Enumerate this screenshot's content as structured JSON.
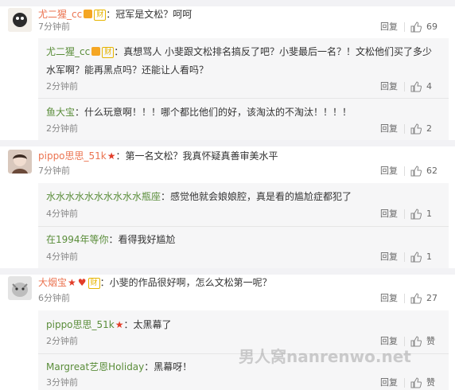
{
  "comments": [
    {
      "user": "尤二猩_cc",
      "text": "：冠军是文松？呵呵",
      "time": "7分钟前",
      "reply": "回复",
      "likes": "69",
      "replies": [
        {
          "user": "尤二猩_cc",
          "text": "：真想骂人 小斐跟文松排名搞反了吧？小斐最后一名？！文松他们买了多少",
          "text2": "水军啊？能再黑点吗？还能让人看吗？",
          "time": "2分钟前",
          "reply": "回复",
          "likes": "4"
        },
        {
          "user": "鱼大宝",
          "text": "：什么玩意啊！！！哪个都比他们的好，该淘汰的不淘汰！！！！",
          "time": "2分钟前",
          "reply": "回复",
          "likes": "2"
        }
      ]
    },
    {
      "user": "pippo思思_51k",
      "text": "：第一名文松？我真怀疑真善审美水平",
      "time": "7分钟前",
      "reply": "回复",
      "likes": "62",
      "replies": [
        {
          "user": "水水水水水水水水水水瓶座",
          "text": "：感觉他就会娘娘腔，真是看的尴尬症都犯了",
          "time": "4分钟前",
          "reply": "回复",
          "likes": "1"
        },
        {
          "user": "在1994年等你",
          "text": "：看得我好尴尬",
          "time": "4分钟前",
          "reply": "回复",
          "likes": "1"
        }
      ]
    },
    {
      "user": "大烟宝",
      "text": "：小斐的作品很好啊，怎么文松第一呢？",
      "time": "6分钟前",
      "reply": "回复",
      "likes": "27",
      "replies": [
        {
          "user": "pippo思思_51k",
          "text": "：太黑幕了",
          "time": "2分钟前",
          "reply": "回复",
          "likes": "赞"
        },
        {
          "user": "Margreat艺恩Holiday",
          "text": "：黑幕呀！",
          "time": "3分钟前",
          "reply": "回复",
          "likes": "赞"
        }
      ]
    }
  ],
  "badge_text": "财",
  "watermark": "男人窝nanrenwo.net",
  "colors": {
    "username": "#eb7350",
    "reply_username": "#5a8d3a",
    "time": "#888888"
  }
}
